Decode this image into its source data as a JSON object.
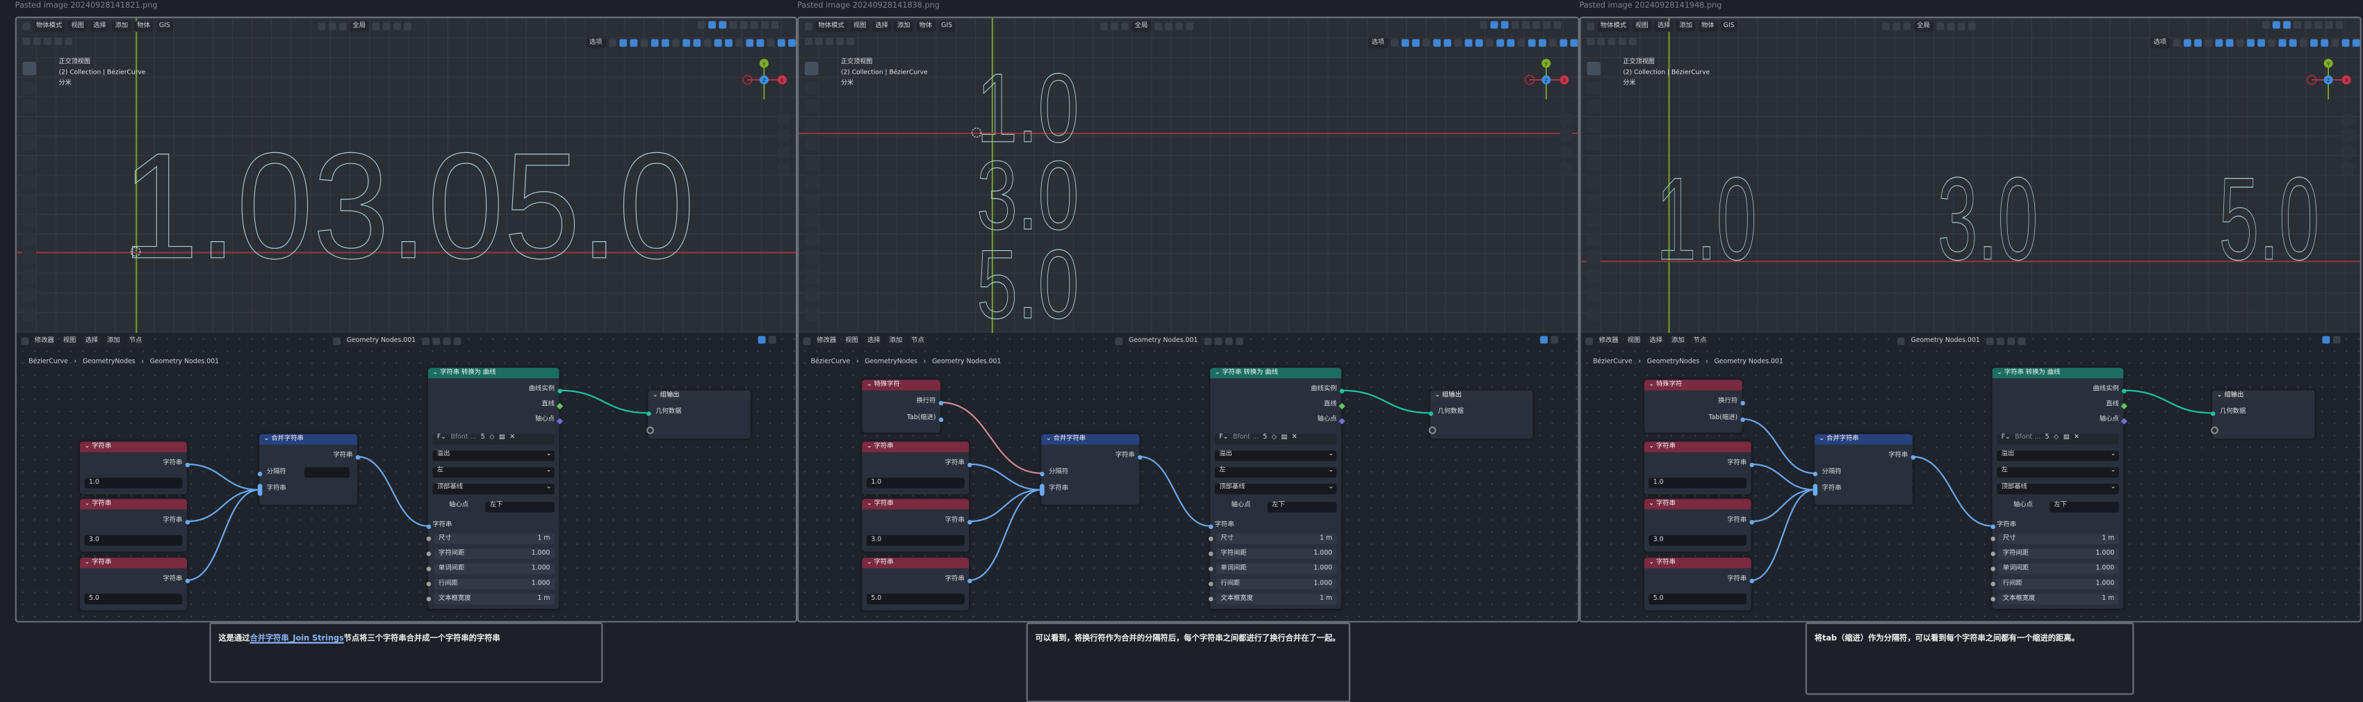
{
  "panels": [
    {
      "title": "Pasted image 20240928141821.png",
      "viewport_text": [
        "1.03.05.0"
      ],
      "has_special": false
    },
    {
      "title": "Pasted image 20240928141838.png",
      "viewport_text": [
        "1.0",
        "3.0",
        "5.0"
      ],
      "has_special": true,
      "separator_from": "newline"
    },
    {
      "title": "Pasted image 20240928141948.png",
      "viewport_text": [
        "1.0         3.0         5.0"
      ],
      "has_special": true,
      "separator_from": "tab"
    }
  ],
  "viewport": {
    "mode": "物体模式",
    "menus": [
      "视图",
      "选择",
      "添加",
      "物体",
      "GIS"
    ],
    "transform": "全局",
    "options": "选项",
    "info": [
      "正交顶视图",
      "(2) Collection | BézierCurve",
      "分米"
    ],
    "gizmo": {
      "y": "Y",
      "z": "Z",
      "x": "X"
    }
  },
  "node_editor": {
    "editor_type": "修改器",
    "menus": [
      "视图",
      "选择",
      "添加",
      "节点"
    ],
    "tree_name": "Geometry Nodes.001",
    "breadcrumb": [
      "BézierCurve",
      "GeometryNodes",
      "Geometry Nodes.001"
    ]
  },
  "nodes": {
    "string": {
      "title": "字符串",
      "output": "字符串",
      "values": [
        "1.0",
        "3.0",
        "5.0"
      ]
    },
    "special": {
      "title": "特殊字符",
      "outputs": [
        "换行符",
        "Tab(缩进)"
      ]
    },
    "join": {
      "title": "合并字符串",
      "output": "字符串",
      "inputs": [
        "分隔符",
        "字符串"
      ]
    },
    "text_to_curves": {
      "title": "字符串 转换为 曲线",
      "outputs": [
        "曲线实例",
        "直线",
        "轴心点"
      ],
      "font": "Bfont ...",
      "font_users": "5",
      "overflow": "溢出",
      "align_x": "左",
      "align_y": "顶部基线",
      "pivot_label": "轴心点",
      "pivot_value": "左下",
      "string_input": "字符串",
      "props": [
        [
          "尺寸",
          "1 m"
        ],
        [
          "字符间距",
          "1.000"
        ],
        [
          "单词间距",
          "1.000"
        ],
        [
          "行间距",
          "1.000"
        ],
        [
          "文本框宽度",
          "1 m"
        ]
      ]
    },
    "group_output": {
      "title": "组输出",
      "input": "几何数据"
    }
  },
  "captions": [
    {
      "before": "这是通过",
      "link": "合并字符串_Join Strings",
      "after": "节点将三个字符串合并成一个字符串的字符串"
    },
    {
      "text": "可以看到，将换行符作为合并的分隔符后，每个字符串之间都进行了换行合并在了一起。"
    },
    {
      "text": "将tab（缩进）作为分隔符，可以看到每个字符串之间都有一个缩进的距离。"
    }
  ],
  "colors": {
    "string_header": "#7b2a40",
    "join_header": "#27427f",
    "curve_header": "#1b6e60",
    "link_string": "#6aaaf0",
    "link_newline": "#d48a9a",
    "link_geometry": "#1dc3a0"
  }
}
